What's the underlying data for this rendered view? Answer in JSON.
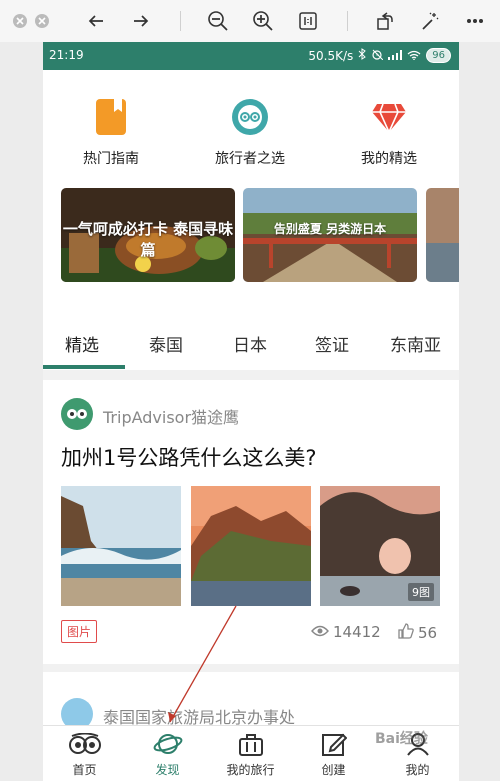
{
  "viewer": {
    "buttons": [
      "close",
      "minimize",
      "back-arrow",
      "forward-arrow",
      "zoom-out",
      "zoom-in",
      "actual-size",
      "rotate",
      "magic-wand",
      "more"
    ]
  },
  "status_bar": {
    "time": "21:19",
    "speed": "50.5K/s",
    "battery": "96"
  },
  "quick_links": [
    {
      "label": "热门指南",
      "icon": "book-icon"
    },
    {
      "label": "旅行者之选",
      "icon": "tripadvisor-laurel-icon"
    },
    {
      "label": "我的精选",
      "icon": "diamond-icon"
    }
  ],
  "banners": [
    {
      "text": "一气呵成必打卡 泰国寻味篇"
    },
    {
      "text": "告别盛夏 另类游日本"
    }
  ],
  "tabs": [
    "精选",
    "泰国",
    "日本",
    "签证",
    "东南亚"
  ],
  "post": {
    "author": "TripAdvisor猫途鹰",
    "title": "加州1号公路凭什么这么美?",
    "image_count": "9图",
    "tag": "图片",
    "views": "14412",
    "likes": "56"
  },
  "post2": {
    "author": "泰国国家旅游局北京办事处"
  },
  "bottom_nav": [
    {
      "label": "首页",
      "icon": "owl-icon"
    },
    {
      "label": "发现",
      "icon": "planet-icon"
    },
    {
      "label": "我的旅行",
      "icon": "suitcase-icon"
    },
    {
      "label": "创建",
      "icon": "edit-icon"
    },
    {
      "label": "我的",
      "icon": "profile-icon"
    }
  ],
  "watermark": "Bai经验",
  "colors": {
    "brand": "#2d7f6b",
    "tag_red": "#e04b4b",
    "annotation_arrow": "#c0392b"
  }
}
